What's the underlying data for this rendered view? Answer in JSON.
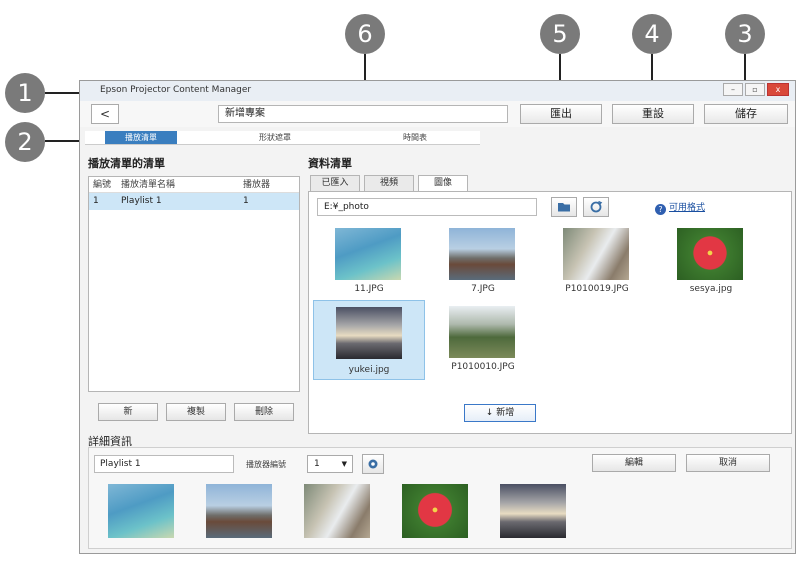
{
  "callouts": [
    "1",
    "2",
    "3",
    "4",
    "5",
    "6"
  ],
  "window": {
    "title": "Epson Projector Content Manager",
    "controls": [
      "–",
      "▫",
      "x"
    ]
  },
  "toolbar": {
    "back_label": "<",
    "project_name": "新增專案",
    "export_label": "匯出",
    "reset_label": "重設",
    "save_label": "儲存"
  },
  "steps": [
    "播放清單",
    "形狀遮罩",
    "時間表"
  ],
  "playlists": {
    "title": "播放清單的清單",
    "columns": [
      "編號",
      "播放清單名稱",
      "播放器"
    ],
    "rows": [
      {
        "no": "1",
        "name": "Playlist 1",
        "player": "1"
      }
    ],
    "buttons": {
      "new": "新",
      "copy": "複製",
      "delete": "刪除"
    }
  },
  "data_list": {
    "title": "資料清單",
    "tabs": [
      "已匯入",
      "視頻",
      "圖像"
    ],
    "active_tab": 2,
    "path": "E:¥_photo",
    "help_label": "可用格式",
    "thumbnails": [
      {
        "label": "11.JPG",
        "pic": "sea"
      },
      {
        "label": "7.JPG",
        "pic": "fuji"
      },
      {
        "label": "P1010019.JPG",
        "pic": "falls"
      },
      {
        "label": "sesya.jpg",
        "pic": "flower"
      },
      {
        "label": "yukei.jpg",
        "pic": "sunset"
      },
      {
        "label": "P1010010.JPG",
        "pic": "park"
      }
    ],
    "selected_thumbnail": "yukei.jpg",
    "add_label": "↓ 新增"
  },
  "details": {
    "title": "詳細資訊",
    "playlist_name": "Playlist 1",
    "player_label": "播放器編號",
    "player_value": "1",
    "edit_label": "編輯",
    "cancel_label": "取消",
    "strip": [
      "sea",
      "fuji",
      "falls",
      "flower",
      "sunset"
    ]
  },
  "colors": {
    "accent": "#3a7ebf",
    "selection": "#cde6f7",
    "callout": "#7a7a7a"
  }
}
